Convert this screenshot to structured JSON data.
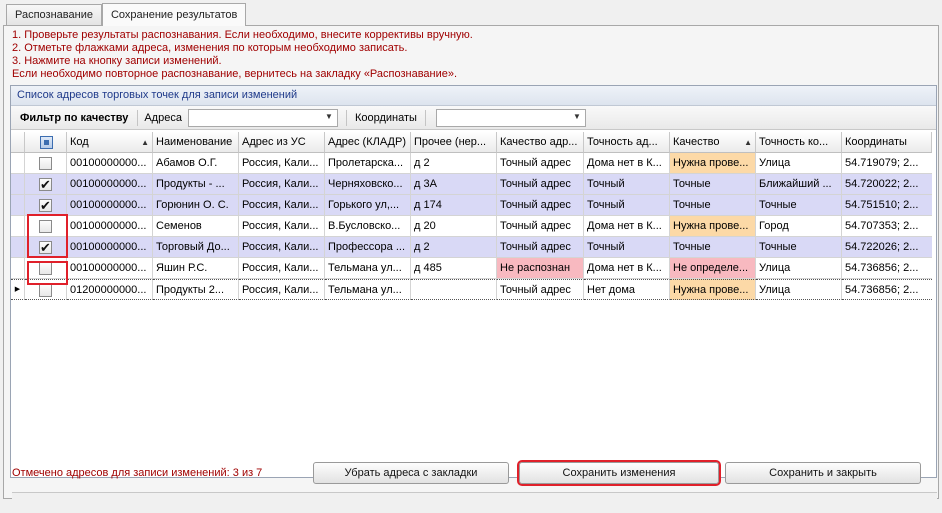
{
  "tabs": [
    {
      "label": "Распознавание",
      "active": false
    },
    {
      "label": "Сохранение результатов",
      "active": true
    }
  ],
  "instructions": [
    "1. Проверьте результаты распознавания. Если необходимо, внесите коррективы вручную.",
    "2. Отметьте флажками адреса, изменения по которым необходимо записать.",
    "3. Нажмите на кнопку записи изменений.",
    "Если необходимо повторное распознавание, вернитесь на закладку «Распознавание»."
  ],
  "grid_caption": "Список адресов торговых точек для записи изменений",
  "filter": {
    "label": "Фильтр по качеству",
    "address_label": "Адреса",
    "address_value": "",
    "coords_label": "Координаты",
    "coords_value": ""
  },
  "columns": [
    "Код",
    "Наименование",
    "Адрес из УС",
    "Адрес (КЛАДР)",
    "Прочее (нер...",
    "Качество адр...",
    "Точность ад...",
    "Качество",
    "Точность ко...",
    "Координаты"
  ],
  "rows": [
    {
      "checked": false,
      "selected": false,
      "cells": [
        "00100000000...",
        "Абамов О.Г.",
        "Россия, Кали...",
        "Пролетарска...",
        "д 2",
        "Точный адрес",
        "Дома нет в К...",
        "Нужна прове...",
        "Улица",
        "54.719079; 2..."
      ]
    },
    {
      "checked": true,
      "selected": true,
      "cells": [
        "00100000000...",
        "Продукты - ...",
        "Россия, Кали...",
        "Черняховско...",
        "д 3А",
        "Точный адрес",
        "Точный",
        "Точные",
        "Ближайший ...",
        "54.720022; 2..."
      ]
    },
    {
      "checked": true,
      "selected": true,
      "cells": [
        "00100000000...",
        "Горюнин О. С.",
        "Россия, Кали...",
        "Горького ул,...",
        "д 174",
        "Точный адрес",
        "Точный",
        "Точные",
        "Точные",
        "54.751510; 2..."
      ]
    },
    {
      "checked": false,
      "selected": false,
      "cells": [
        "00100000000...",
        "Семенов",
        "Россия, Кали...",
        "В.Бусловско...",
        "д 20",
        "Точный адрес",
        "Дома нет в К...",
        "Нужна прове...",
        "Город",
        "54.707353; 2..."
      ]
    },
    {
      "checked": true,
      "selected": true,
      "cells": [
        "00100000000...",
        "Торговый До...",
        "Россия, Кали...",
        "Профессора ...",
        "д 2",
        "Точный адрес",
        "Точный",
        "Точные",
        "Точные",
        "54.722026; 2..."
      ]
    },
    {
      "checked": false,
      "selected": false,
      "cells": [
        "00100000000...",
        "Яшин Р.С.",
        "Россия, Кали...",
        "Тельмана ул...",
        "д 485",
        "Не распознан",
        "Дома нет в К...",
        "Не определе...",
        "Улица",
        "54.736856; 2..."
      ]
    },
    {
      "checked": false,
      "selected": false,
      "current": true,
      "cells": [
        "01200000000...",
        "Продукты 2...",
        "Россия, Кали...",
        "Тельмана ул...",
        "",
        "Точный адрес",
        "Нет дома",
        "Нужна прове...",
        "Улица",
        "54.736856; 2..."
      ]
    }
  ],
  "status_text": "Отмечено адресов для записи изменений: 3 из 7",
  "buttons": {
    "remove": "Убрать адреса с закладки",
    "save": "Сохранить изменения",
    "save_close": "Сохранить и закрыть"
  },
  "colors": {
    "attention": "#fcd9a7",
    "error": "#f8b9c0",
    "selected_row": "#d9d9f6",
    "highlight_frame": "#e0202a"
  }
}
